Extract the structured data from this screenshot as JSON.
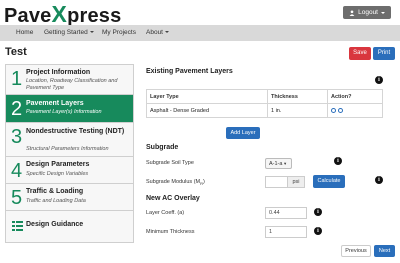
{
  "brand": {
    "part1": "Pave",
    "part2": "X",
    "part3": "press"
  },
  "header": {
    "logout_label": "Logout"
  },
  "nav": {
    "items": [
      {
        "label": "Home"
      },
      {
        "label": "Getting Started"
      },
      {
        "label": "My Projects"
      },
      {
        "label": "About"
      }
    ]
  },
  "page": {
    "title": "Test",
    "save_label": "Save",
    "print_label": "Print"
  },
  "sidebar": {
    "steps": [
      {
        "num": "1",
        "title": "Project Information",
        "sub": "Location, Roadway Classification and Pavement Type"
      },
      {
        "num": "2",
        "title": "Pavement Layers",
        "sub": "Pavement Layer(s) Information"
      },
      {
        "num": "3",
        "title": "Nondestructive Testing (NDT)",
        "sub": "Structural Parameters Information"
      },
      {
        "num": "4",
        "title": "Design Parameters",
        "sub": "Specific Design Variables"
      },
      {
        "num": "5",
        "title": "Traffic & Loading",
        "sub": "Traffic and Loading Data"
      }
    ],
    "guidance_label": "Design Guidance"
  },
  "layers": {
    "heading": "Existing Pavement Layers",
    "columns": [
      "Layer Type",
      "Thickness",
      "Action?"
    ],
    "rows": [
      {
        "type": "Asphalt - Dense Graded",
        "thickness": "1 in."
      }
    ],
    "add_label": "Add Layer"
  },
  "subgrade": {
    "heading": "Subgrade",
    "soil_label": "Subgrade Soil Type",
    "soil_value": "A-1-a",
    "modulus_label": "Subgrade Modulus (M",
    "modulus_sub": "R",
    "modulus_close": ")",
    "modulus_unit": "psi",
    "calculate_label": "Calculate"
  },
  "overlay": {
    "heading": "New AC Overlay",
    "layer_coeff_label": "Layer Coeff. (a)",
    "layer_coeff_value": "0.44",
    "min_thickness_label": "Minimum Thickness",
    "min_thickness_value": "1"
  },
  "footer": {
    "previous_label": "Previous",
    "next_label": "Next"
  },
  "colors": {
    "brand_green": "#178a5c",
    "primary_blue": "#2a6ebb",
    "danger_red": "#d9363e"
  }
}
